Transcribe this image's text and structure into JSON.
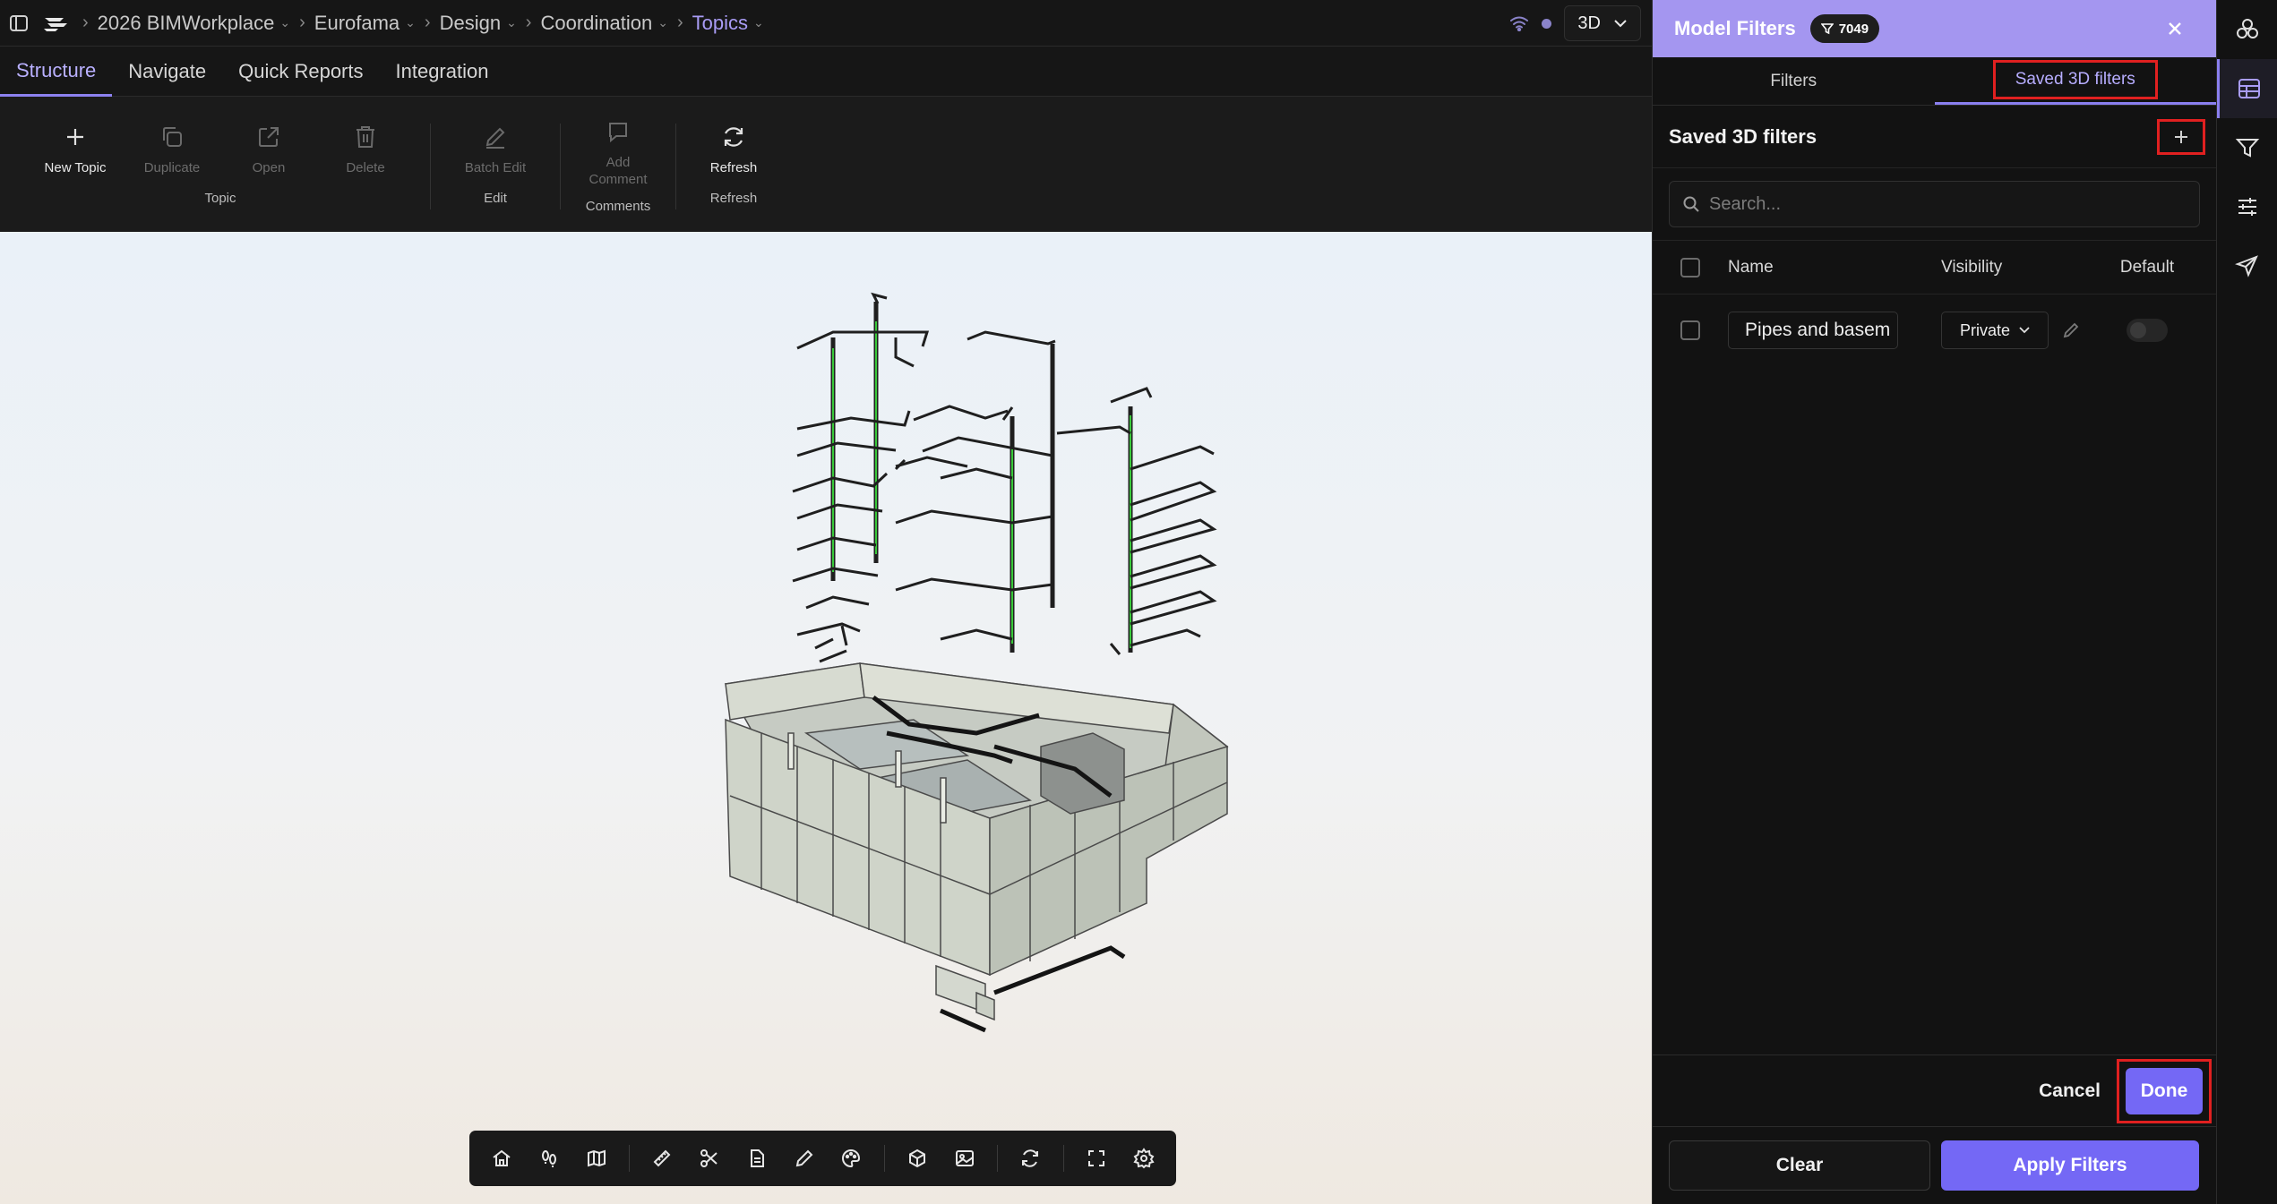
{
  "breadcrumb": {
    "items": [
      {
        "label": "2026 BIMWorkplace"
      },
      {
        "label": "Eurofama"
      },
      {
        "label": "Design"
      },
      {
        "label": "Coordination"
      },
      {
        "label": "Topics"
      }
    ]
  },
  "header": {
    "view_mode": "3D"
  },
  "tabs": [
    {
      "label": "Structure"
    },
    {
      "label": "Navigate"
    },
    {
      "label": "Quick Reports"
    },
    {
      "label": "Integration"
    }
  ],
  "ribbon": {
    "groups": [
      {
        "name": "Topic",
        "buttons": [
          {
            "label": "New Topic",
            "icon": "plus-icon"
          },
          {
            "label": "Duplicate",
            "icon": "copy-icon"
          },
          {
            "label": "Open",
            "icon": "external-link-icon"
          },
          {
            "label": "Delete",
            "icon": "trash-icon"
          }
        ]
      },
      {
        "name": "Edit",
        "buttons": [
          {
            "label": "Batch Edit",
            "icon": "pencil-icon"
          }
        ]
      },
      {
        "name": "Comments",
        "buttons": [
          {
            "label": "Add Comment",
            "icon": "comment-icon"
          }
        ]
      },
      {
        "name": "Refresh",
        "buttons": [
          {
            "label": "Refresh",
            "icon": "refresh-icon"
          }
        ]
      }
    ]
  },
  "viewer_toolbar": {
    "icons": [
      "home-icon",
      "walk-icon",
      "map-icon",
      "ruler-icon",
      "scissors-icon",
      "document-icon",
      "pen-icon",
      "palette-icon",
      "cube-icon",
      "image-icon",
      "rotate-icon",
      "fullscreen-icon",
      "settings-icon"
    ]
  },
  "panel": {
    "title": "Model Filters",
    "badge_count": "7049",
    "tabs": [
      {
        "label": "Filters"
      },
      {
        "label": "Saved 3D filters"
      }
    ],
    "section_title": "Saved 3D filters",
    "search_placeholder": "Search...",
    "table": {
      "headers": {
        "name": "Name",
        "visibility": "Visibility",
        "default": "Default"
      },
      "rows": [
        {
          "name": "Pipes and basem",
          "visibility": "Private",
          "default": false
        }
      ]
    },
    "cancel_label": "Cancel",
    "done_label": "Done",
    "clear_label": "Clear",
    "apply_label": "Apply Filters"
  },
  "colors": {
    "accent": "#7468f5",
    "header": "#a496f0",
    "highlight": "#e02020"
  },
  "rail": {
    "icons": [
      "layers-icon",
      "table-icon",
      "filter-icon",
      "sliders-icon",
      "send-icon"
    ]
  }
}
